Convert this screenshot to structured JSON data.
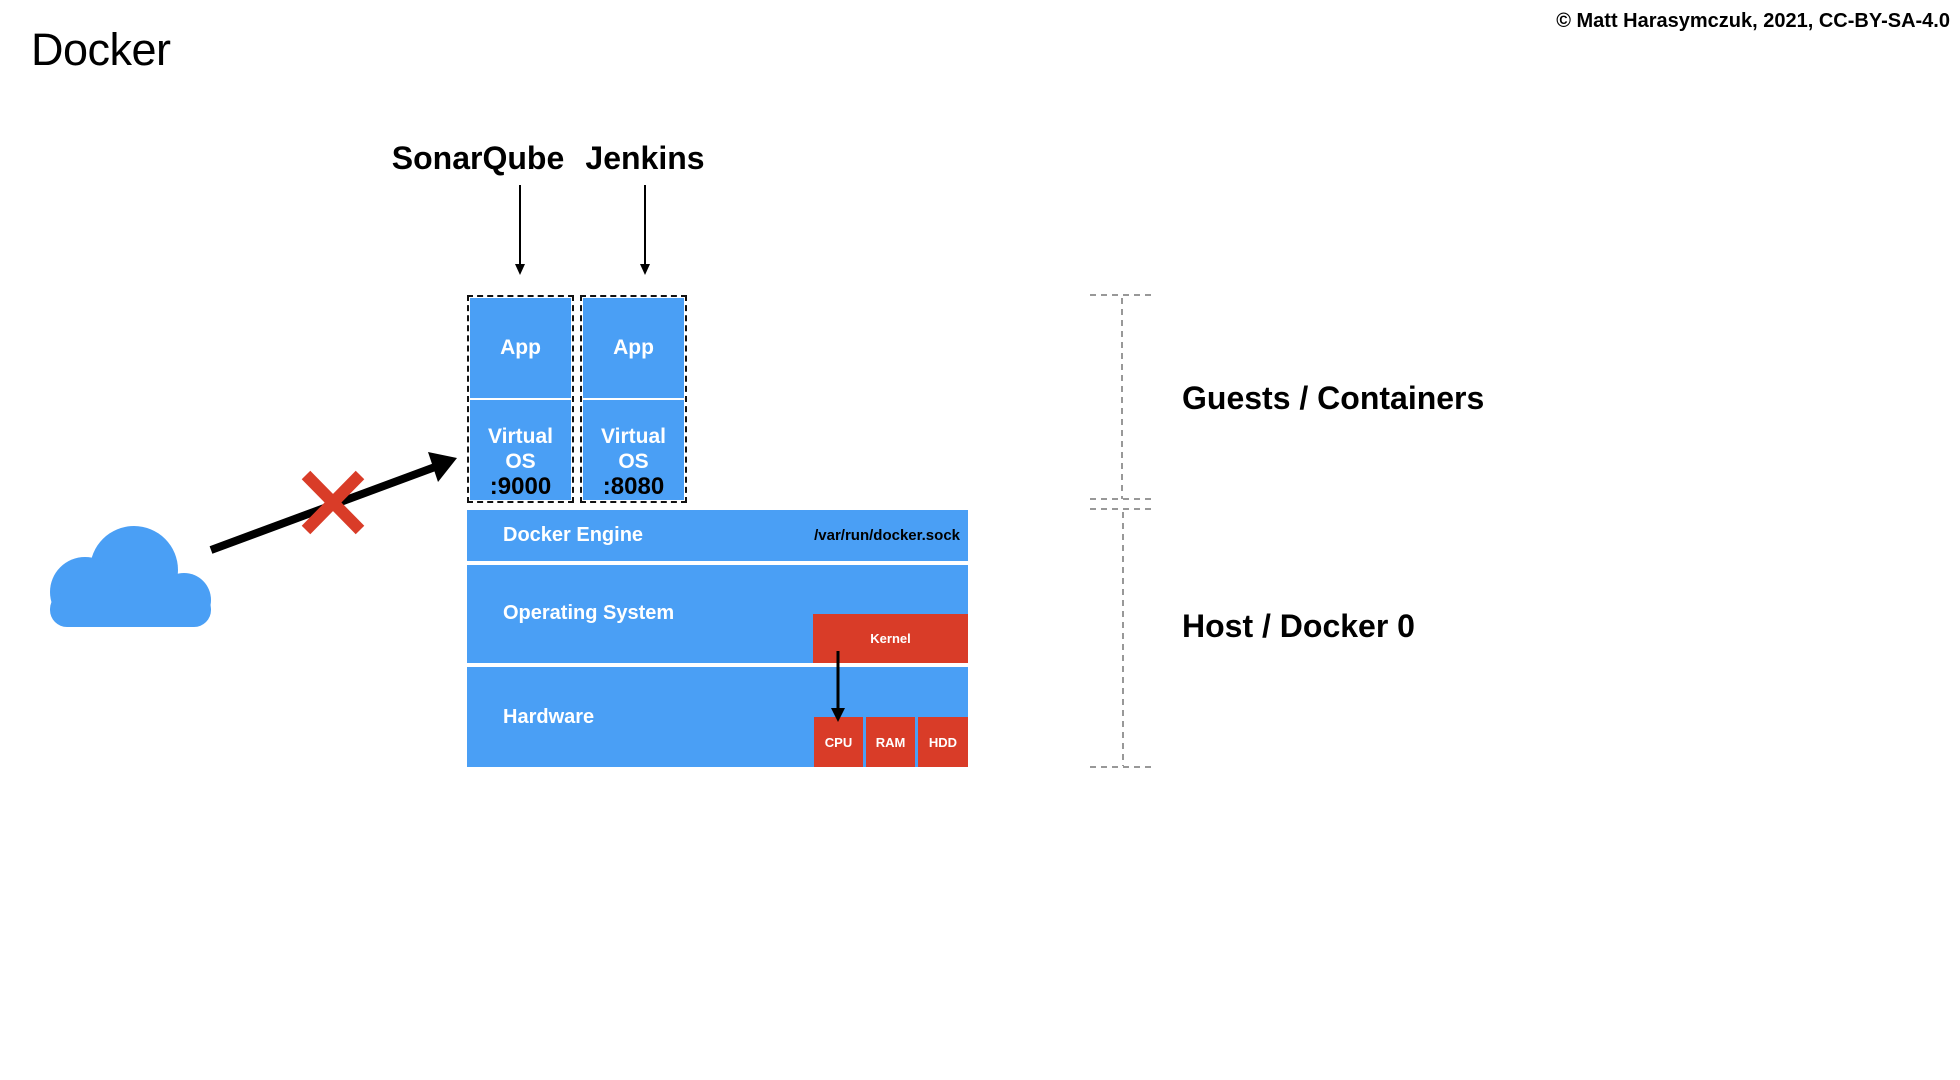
{
  "slide": {
    "title": "Docker",
    "copyright": "© Matt Harasymczuk, 2021, CC-BY-SA-4.0"
  },
  "containers": [
    {
      "name": "SonarQube",
      "app_label": "App",
      "os_line1": "Virtual",
      "os_line2": "OS",
      "port": ":9000"
    },
    {
      "name": "Jenkins",
      "app_label": "App",
      "os_line1": "Virtual",
      "os_line2": "OS",
      "port": ":8080"
    }
  ],
  "host_layers": {
    "engine": {
      "label": "Docker Engine",
      "socket": "/var/run/docker.sock"
    },
    "os": {
      "label": "Operating System",
      "kernel": "Kernel"
    },
    "hardware": {
      "label": "Hardware",
      "components": [
        "CPU",
        "RAM",
        "HDD"
      ]
    }
  },
  "brackets": {
    "guests": "Guests / Containers",
    "host": "Host / Docker 0"
  },
  "external": {
    "icon": "cloud-icon",
    "blocked_icon": "cross-icon",
    "connection_state": "blocked"
  },
  "colors": {
    "layer_blue": "#4a9ff5",
    "component_red": "#d93c28",
    "cross_red": "#d93c28"
  }
}
